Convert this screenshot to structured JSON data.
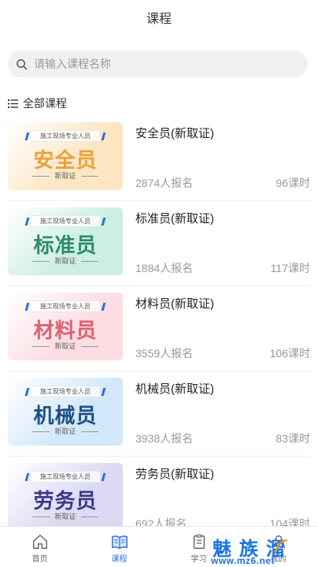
{
  "header": {
    "title": "课程"
  },
  "search": {
    "placeholder": "请输入课程名称"
  },
  "section": {
    "title": "全部课程"
  },
  "courses": [
    {
      "thumb_tag": "施工现场专业人员",
      "thumb_title": "安全员",
      "thumb_sub": "新取证",
      "thumb_bg": "#fce6c4",
      "thumb_color": "#e8a23a",
      "name": "安全员(新取证)",
      "enroll": "2874人报名",
      "hours": "96课时"
    },
    {
      "thumb_tag": "施工现场专业人员",
      "thumb_title": "标准员",
      "thumb_sub": "新取证",
      "thumb_bg": "#cdeee3",
      "thumb_color": "#2f8a6a",
      "name": "标准员(新取证)",
      "enroll": "1884人报名",
      "hours": "117课时"
    },
    {
      "thumb_tag": "施工现场专业人员",
      "thumb_title": "材料员",
      "thumb_sub": "新取证",
      "thumb_bg": "#fbdde2",
      "thumb_color": "#e0606f",
      "name": "材料员(新取证)",
      "enroll": "3559人报名",
      "hours": "106课时"
    },
    {
      "thumb_tag": "施工现场专业人员",
      "thumb_title": "机械员",
      "thumb_sub": "新取证",
      "thumb_bg": "#d3e8f8",
      "thumb_color": "#1f4f86",
      "name": "机械员(新取证)",
      "enroll": "3938人报名",
      "hours": "83课时"
    },
    {
      "thumb_tag": "施工现场专业人员",
      "thumb_title": "劳务员",
      "thumb_sub": "新取证",
      "thumb_bg": "#dcd9f3",
      "thumb_color": "#3a3a8a",
      "name": "劳务员(新取证)",
      "enroll": "692人报名",
      "hours": "104课时"
    }
  ],
  "tabbar": {
    "items": [
      {
        "label": "首页",
        "icon": "home-icon",
        "active": false
      },
      {
        "label": "课程",
        "icon": "book-icon",
        "active": true
      },
      {
        "label": "学习",
        "icon": "clipboard-icon",
        "active": false
      },
      {
        "label": "我的",
        "icon": "user-icon",
        "active": false
      }
    ]
  },
  "watermark": {
    "brand": "魅族溜",
    "url": "www.mz6.net"
  },
  "colors": {
    "accent": "#2a6fd6",
    "watermark": "#1a73e8"
  }
}
